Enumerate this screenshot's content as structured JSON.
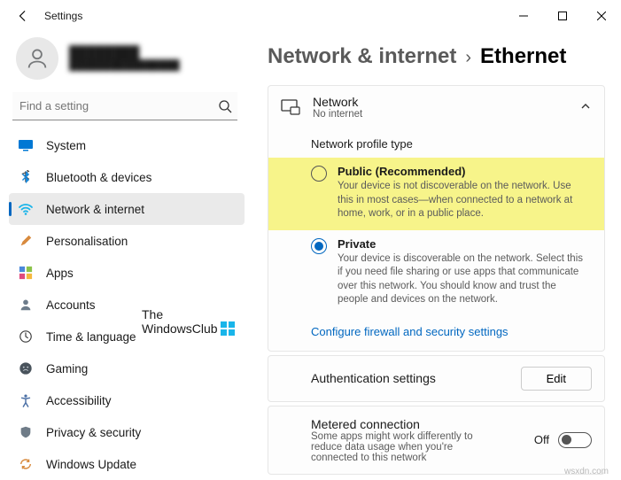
{
  "titlebar": {
    "title": "Settings"
  },
  "profile": {
    "name": "████████",
    "email": "████████████████"
  },
  "search": {
    "placeholder": "Find a setting"
  },
  "sidebar": {
    "items": [
      {
        "label": "System"
      },
      {
        "label": "Bluetooth & devices"
      },
      {
        "label": "Network & internet"
      },
      {
        "label": "Personalisation"
      },
      {
        "label": "Apps"
      },
      {
        "label": "Accounts"
      },
      {
        "label": "Time & language"
      },
      {
        "label": "Gaming"
      },
      {
        "label": "Accessibility"
      },
      {
        "label": "Privacy & security"
      },
      {
        "label": "Windows Update"
      }
    ]
  },
  "breadcrumb": {
    "parent": "Network & internet",
    "sep": "›",
    "current": "Ethernet"
  },
  "network_card": {
    "title": "Network",
    "sub": "No internet"
  },
  "profile_type": {
    "heading": "Network profile type",
    "public": {
      "title": "Public (Recommended)",
      "desc": "Your device is not discoverable on the network. Use this in most cases—when connected to a network at home, work, or in a public place."
    },
    "private": {
      "title": "Private",
      "desc": "Your device is discoverable on the network. Select this if you need file sharing or use apps that communicate over this network. You should know and trust the people and devices on the network."
    },
    "link": "Configure firewall and security settings"
  },
  "auth": {
    "title": "Authentication settings",
    "button": "Edit"
  },
  "metered": {
    "title": "Metered connection",
    "desc": "Some apps might work differently to reduce data usage when you're connected to this network",
    "state": "Off"
  },
  "watermark": {
    "line1": "The",
    "line2": "WindowsClub"
  },
  "footer": "wsxdn.com"
}
